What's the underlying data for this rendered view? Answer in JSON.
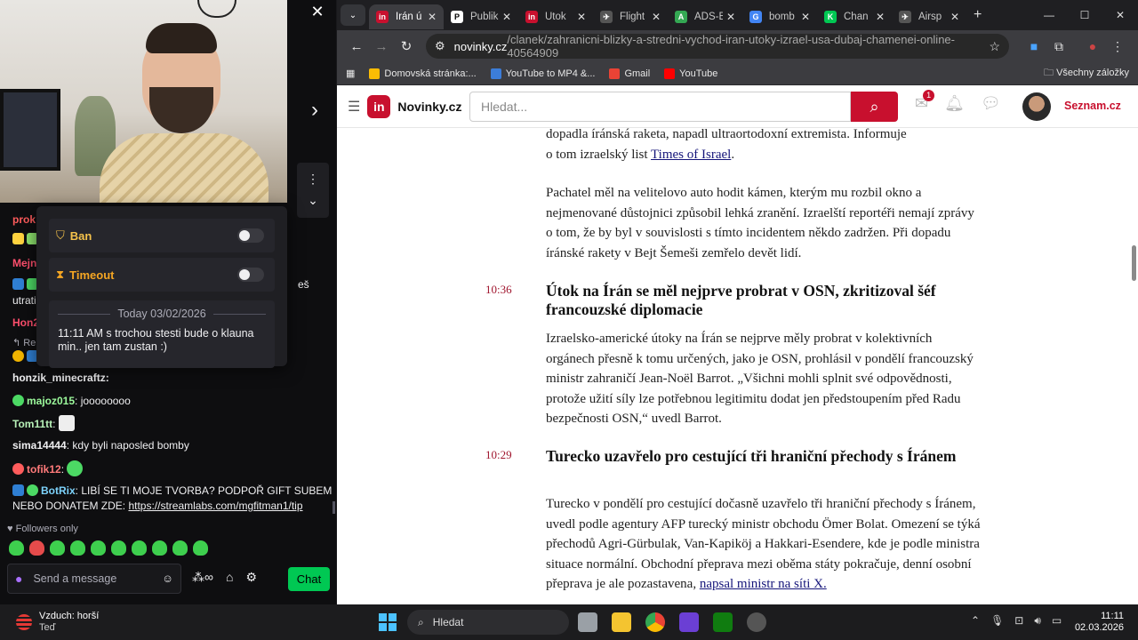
{
  "webcam": {
    "close_label": "✕"
  },
  "mod_popup": {
    "ban_label": "Ban",
    "timeout_label": "Timeout",
    "date_divider": "Today 03/02/2026",
    "message": "11:11 AM s trochou stesti bude o klauna min.. jen tam zustan :)"
  },
  "chat": {
    "partials": [
      {
        "text": "prok",
        "color": "#ff5c5c"
      },
      {
        "text": "Mejn",
        "color": "#ff4f6d"
      },
      {
        "text": "utrati",
        "color": "#efeff1"
      },
      {
        "text": "Hon2",
        "color": "#ff4f6d"
      },
      {
        "text": "Re",
        "color": "#adadb8"
      },
      {
        "text": "honzik_minecraftz:",
        "color": "#efeff1"
      }
    ],
    "messages": [
      {
        "user": "majoz015",
        "user_color": "#9cfa9c",
        "text": "joooooooo"
      },
      {
        "user": "Tom11tt",
        "user_color": "#b7f0b7",
        "text": ""
      },
      {
        "user": "sima14444",
        "user_color": "#efeff1",
        "text": "kdy byli naposled bomby"
      },
      {
        "user": "tofik12",
        "user_color": "#ff7a7a",
        "text": ""
      },
      {
        "user": "BotRix",
        "user_color": "#7dd3fc",
        "text": "LIBÍ SE TI MOJE TVORBA? PODPOŘ GIFT SUBEM",
        "text2": "NEBO DONATEM ZDE: ",
        "link": "https://streamlabs.com/mgfitman1/tip"
      }
    ],
    "followers_only": "Followers only",
    "input_placeholder": "Send a message",
    "chat_button": "Chat",
    "side_cut": "eš"
  },
  "browser": {
    "tabs": [
      {
        "title": "Írán ú",
        "fav_color": "#c8102e",
        "fav": "in",
        "active": true
      },
      {
        "title": "Publik",
        "fav_color": "#ffffff",
        "fav": "P",
        "active": false
      },
      {
        "title": "Útok",
        "fav_color": "#c8102e",
        "fav": "in",
        "active": false
      },
      {
        "title": "Flight",
        "fav_color": "#555555",
        "fav": "✈",
        "active": false
      },
      {
        "title": "ADS-B",
        "fav_color": "#34a853",
        "fav": "A",
        "active": false
      },
      {
        "title": "bomb",
        "fav_color": "#4285f4",
        "fav": "G",
        "active": false
      },
      {
        "title": "Chan",
        "fav_color": "#00c853",
        "fav": "K",
        "active": false
      },
      {
        "title": "Airsp",
        "fav_color": "#555555",
        "fav": "✈",
        "active": false
      }
    ],
    "url_domain": "novinky.cz",
    "url_path": "/clanek/zahranicni-blizky-a-stredni-vychod-iran-utoky-izrael-usa-dubaj-chamenei-online-40564909",
    "bookmarks": [
      {
        "label": "Domovská stránka:...",
        "color": "#fbbc04"
      },
      {
        "label": "YouTube to MP4 &...",
        "color": "#3c7dd9"
      },
      {
        "label": "Gmail",
        "color": "#ea4335"
      },
      {
        "label": "YouTube",
        "color": "#ff0000"
      }
    ],
    "all_bookmarks": "Všechny záložky"
  },
  "site": {
    "logo": "in",
    "name": "Novinky.cz",
    "search_placeholder": "Hledat...",
    "mail_count": "1",
    "seznam": "Seznam.cz"
  },
  "article": {
    "intro_line1": "dopadla íránská raketa, napadl ultraortodoxní extremista. Informuje",
    "intro_line2_pre": "o tom izraelský list ",
    "intro_link": "Times of Israel",
    "intro_line2_post": ".",
    "para1": "Pachatel měl na velitelovo auto hodit kámen, kterým mu rozbil okno a nejmenované důstojnici způsobil lehká zranění. Izraelští reportéři nemají zprávy o tom, že by byl v souvislosti s tímto incidentem někdo zadržen. Při dopadu íránské rakety v Bejt Šemeši zemřelo devět lidí.",
    "entries": [
      {
        "time": "10:36",
        "title": "Útok na Írán se měl nejprve probrat v OSN, zkritizoval šéf francouzské diplomacie",
        "text": "Izraelsko-americké útoky na Írán se nejprve měly probrat v kolektivních orgánech přesně k tomu určených, jako je OSN, prohlásil v pondělí francouzský ministr zahraničí Jean-Noël Barrot. „Všichni mohli splnit své odpovědnosti, protože užití síly lze potřebnou legitimitu dodat jen předstoupením před Radu bezpečnosti OSN,“ uvedl Barrot."
      },
      {
        "time": "10:29",
        "title": "Turecko uzavřelo pro cestující tři hraniční přechody s Íránem",
        "text": "Turecko v pondělí pro cestující dočasně uzavřelo tři hraniční přechody s Íránem, uvedl podle agentury AFP turecký ministr obchodu Ömer Bolat. Omezení se týká přechodů Agri-Gürbulak, Van-Kapiköj a Hakkari-Esendere, kde je podle ministra situace normální. Obchodní přeprava mezi oběma státy pokračuje, denní osobní přeprava je ale pozastavena,",
        "tail": "napsal ministr na síti X."
      }
    ]
  },
  "taskbar": {
    "weather_title": "Vzduch: horší",
    "weather_sub": "Teď",
    "search": "Hledat",
    "time": "11:11",
    "date": "02.03.2026"
  }
}
